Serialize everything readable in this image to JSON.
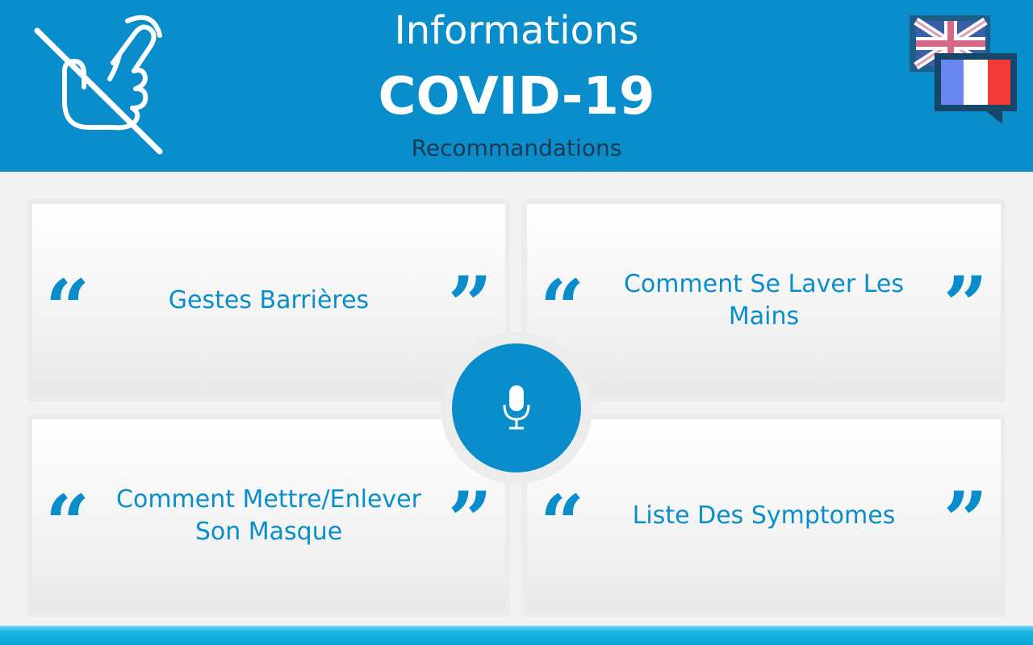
{
  "header": {
    "title_line1": "Informations",
    "title_line2": "COVID-19",
    "subtitle": "Recommandations",
    "left_icon": "no-touch-icon",
    "language_switch": {
      "icon": "uk-fr-flag-speech-bubbles",
      "current_language": "FR",
      "other_language": "EN"
    }
  },
  "cards": [
    {
      "label": "Gestes Barrières"
    },
    {
      "label": "Comment Se Laver Les Mains"
    },
    {
      "label": "Comment Mettre/Enlever Son Masque"
    },
    {
      "label": "Liste Des Symptomes"
    }
  ],
  "quotes": {
    "open": "“",
    "close": "”"
  },
  "mic": {
    "icon": "microphone-icon"
  },
  "colors": {
    "accent": "#0a8ecb",
    "subtitle": "#1b3a4d",
    "background": "#f2f2f2",
    "card": "#ffffff",
    "footer": "#19b6e3"
  }
}
